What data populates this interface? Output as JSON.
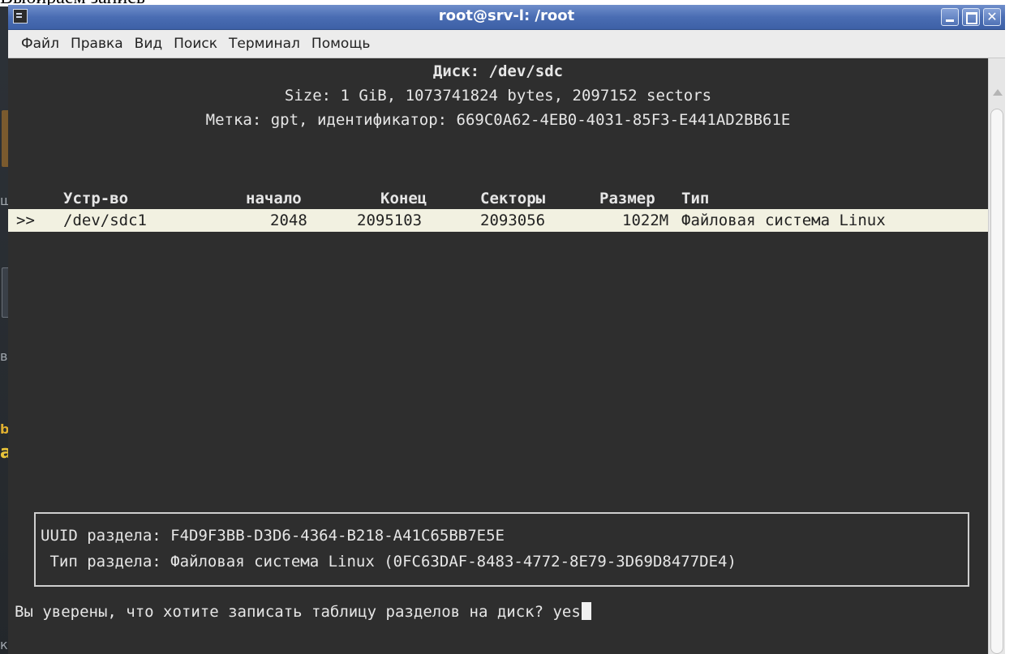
{
  "doc_caption": "Выбираем запись",
  "desktop": {
    "labels": [
      "шние",
      "вые серверы",
      "base",
      "alt (",
      "ктоп"
    ]
  },
  "window": {
    "title": "root@srv-l: /root",
    "buttons": {
      "minimize": "",
      "maximize": "",
      "close": "✕"
    }
  },
  "menu": [
    "Файл",
    "Правка",
    "Вид",
    "Поиск",
    "Терминал",
    "Помощь"
  ],
  "terminal": {
    "disk_title": "Диск: /dev/sdc",
    "size_line": "Size: 1 GiB, 1073741824 bytes, 2097152 sectors",
    "label_line": "Метка: gpt, идентификатор: 669C0A62-4EB0-4031-85F3-E441AD2BB61E",
    "columns": {
      "device": "Устр-во",
      "start": "начало",
      "end": "Конец",
      "sectors": "Секторы",
      "size": "Размер",
      "type": "Тип"
    },
    "rows": [
      {
        "marker": ">>",
        "device": "/dev/sdc1",
        "start": "2048",
        "end": "2095103",
        "sectors": "2093056",
        "size": "1022M",
        "type": "Файловая система Linux"
      }
    ],
    "info_uuid": "UUID раздела: F4D9F3BB-D3D6-4364-B218-A41C65BB7E5E",
    "info_type": " Тип раздела: Файловая система Linux (0FC63DAF-8483-4772-8E79-3D69D8477DE4)",
    "prompt": "Вы уверены, что хотите записать таблицу разделов на диск? ",
    "input_value": "yes"
  }
}
